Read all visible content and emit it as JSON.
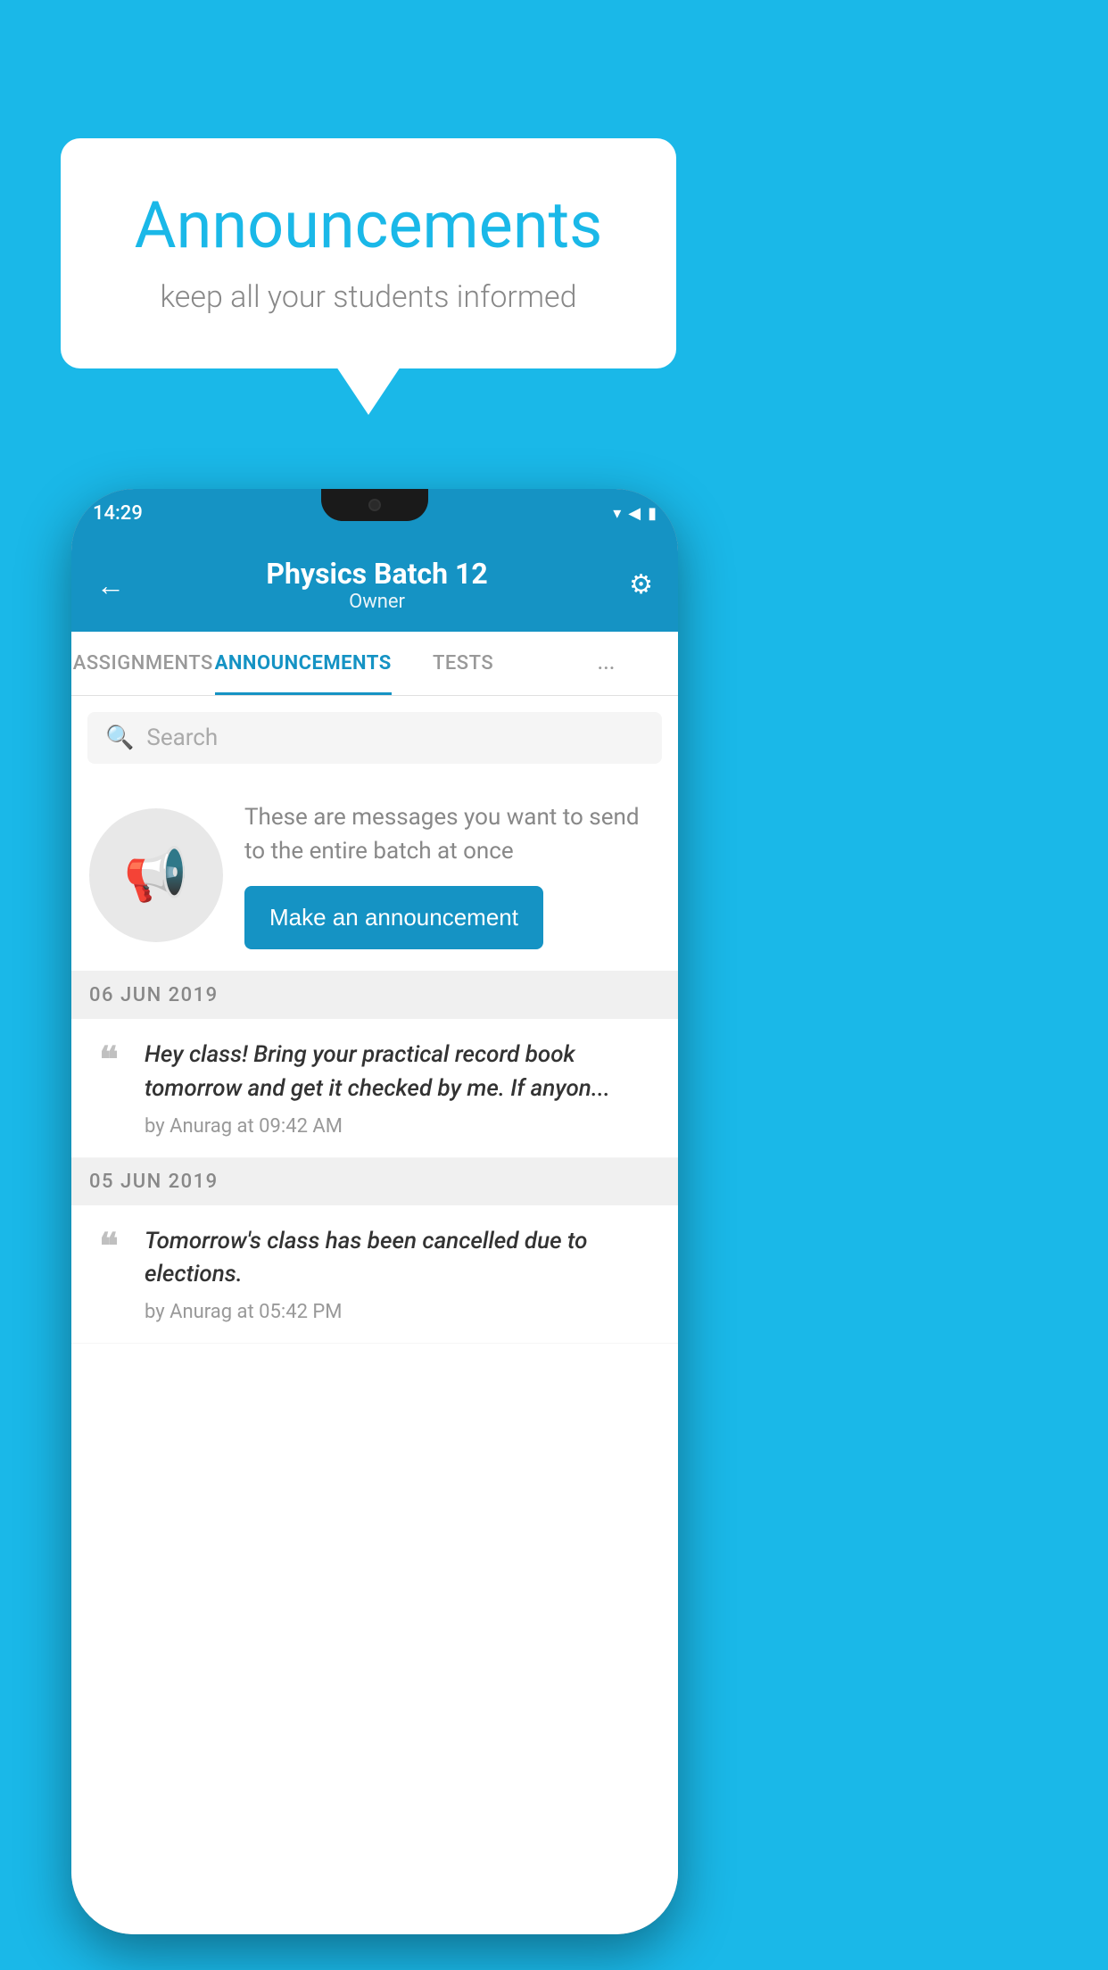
{
  "background_color": "#1ab8e8",
  "bubble": {
    "title": "Announcements",
    "subtitle": "keep all your students informed"
  },
  "phone": {
    "status_bar": {
      "time": "14:29",
      "icons": [
        "wifi",
        "signal",
        "battery"
      ]
    },
    "app_bar": {
      "title": "Physics Batch 12",
      "subtitle": "Owner",
      "back_label": "←",
      "gear_label": "⚙"
    },
    "tabs": [
      {
        "label": "ASSIGNMENTS",
        "active": false
      },
      {
        "label": "ANNOUNCEMENTS",
        "active": true
      },
      {
        "label": "TESTS",
        "active": false
      },
      {
        "label": "...",
        "active": false
      }
    ],
    "search": {
      "placeholder": "Search"
    },
    "promo": {
      "description": "These are messages you want to send to the entire batch at once",
      "button_label": "Make an announcement"
    },
    "announcements": [
      {
        "date": "06  JUN  2019",
        "items": [
          {
            "text": "Hey class! Bring your practical record book tomorrow and get it checked by me. If anyon...",
            "meta": "by Anurag at 09:42 AM"
          }
        ]
      },
      {
        "date": "05  JUN  2019",
        "items": [
          {
            "text": "Tomorrow's class has been cancelled due to elections.",
            "meta": "by Anurag at 05:42 PM"
          }
        ]
      }
    ]
  }
}
